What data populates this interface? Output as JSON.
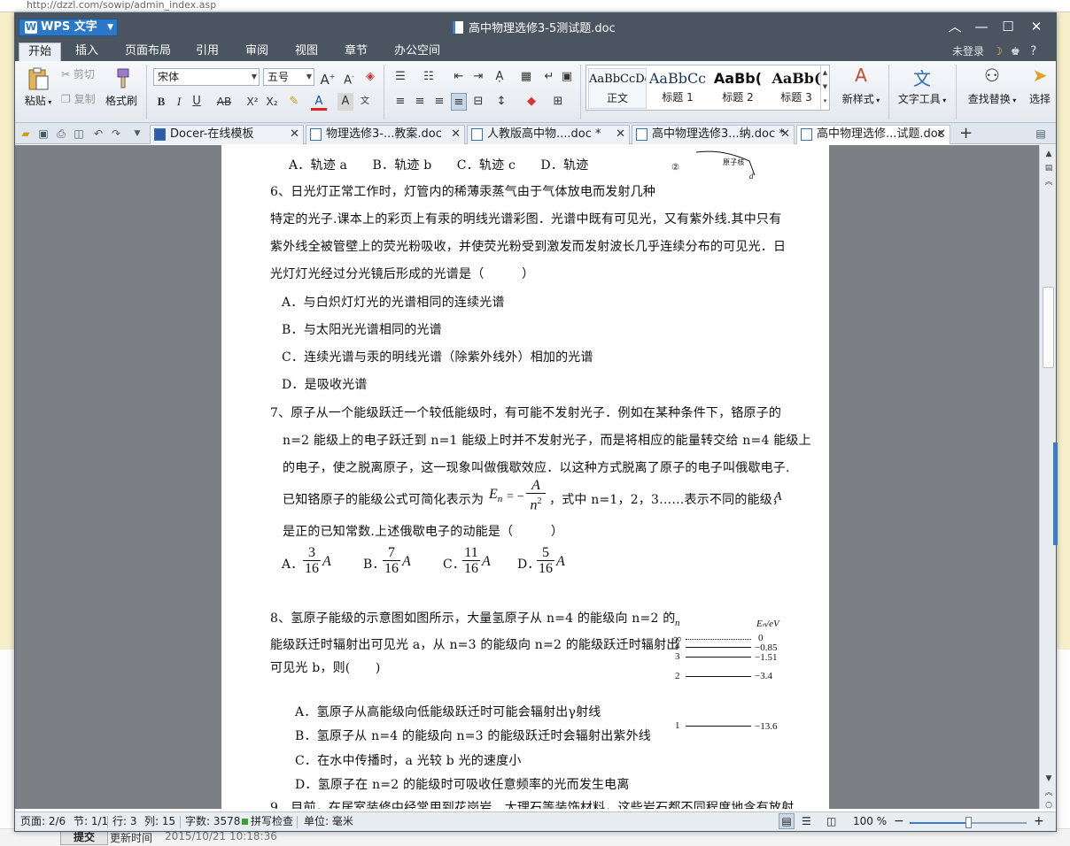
{
  "background": {
    "url": "http://dzzl.com/sowip/admin_index.asp",
    "submit_label": "提交",
    "update_label": "更新时间",
    "update_time": "2015/10/21 10:18:36"
  },
  "window": {
    "app_name": "WPS 文字",
    "doc_title": "高中物理选修3-5测试题.doc",
    "minimize": "—",
    "maximize": "☐",
    "close": "✕",
    "collapse": "︿"
  },
  "menu": {
    "items": [
      "开始",
      "插入",
      "页面布局",
      "引用",
      "审阅",
      "视图",
      "章节",
      "办公空间"
    ],
    "active_index": 0,
    "login": "未登录",
    "help": "?"
  },
  "ribbon": {
    "paste": "粘贴",
    "cut": "剪切",
    "copy": "复制",
    "format_painter": "格式刷",
    "font_name": "宋体",
    "font_size": "五号",
    "bold": "B",
    "italic": "I",
    "underline": "U",
    "strike": "AB",
    "superscript": "X²",
    "subscript": "X₂",
    "styles": [
      {
        "sample": "AaBbCcDd",
        "name": "正文"
      },
      {
        "sample": "AaBbCc",
        "name": "标题 1"
      },
      {
        "sample": "AaBb(",
        "name": "标题 2"
      },
      {
        "sample": "AaBb(",
        "name": "标题 3"
      }
    ],
    "new_style": "新样式",
    "text_tools": "文字工具",
    "find_replace": "查找替换",
    "select": "选择"
  },
  "tabs": [
    {
      "label": "Docer-在线模板",
      "active": false
    },
    {
      "label": "物理选修3-...教案.doc",
      "active": false
    },
    {
      "label": "人教版高中物....doc *",
      "active": false
    },
    {
      "label": "高中物理选修3...纳.doc *",
      "active": false
    },
    {
      "label": "高中物理选修...试题.doc",
      "active": true
    }
  ],
  "document": {
    "q5_options": "A．轨迹 a　　B．轨迹 b　　C．轨迹 c　　D．轨迹",
    "q5_fig_label_2": "②",
    "q5_fig_label_atom": "原子核",
    "q5_fig_label_d": "d",
    "q6_line1": "6、日光灯正常工作时，灯管内的稀薄汞蒸气由于气体放电而发射几种",
    "q6_line2": "特定的光子.课本上的彩页上有汞的明线光谱彩图．光谱中既有可见光，又有紫外线.其中只有",
    "q6_line3": "紫外线全被管壁上的荧光粉吸收，并使荧光粉受到激发而发射波长几乎连续分布的可见光．日",
    "q6_line4": "光灯灯光经过分光镜后形成的光谱是（　　　）",
    "q6_a": "A．与白炽灯灯光的光谱相同的连续光谱",
    "q6_b": "B．与太阳光光谱相同的光谱",
    "q6_c": "C．连续光谱与汞的明线光谱（除紫外线外）相加的光谱",
    "q6_d": "D．是吸收光谱",
    "q7_line1": "7、原子从一个能级跃迁一个较低能级时，有可能不发射光子．例如在某种条件下，铬原子的",
    "q7_line2": "n=2 能级上的电子跃迁到 n=1 能级上时并不发射光子，而是将相应的能量转交给 n=4 能级上",
    "q7_line3": "的电子，使之脱离原子，这一现象叫做俄歇效应．以这种方式脱离了原子的电子叫俄歇电子.",
    "q7_line4a": "已知铬原子的能级公式可简化表示为",
    "q7_formula_lhs": "E",
    "q7_formula_sub": "n",
    "q7_formula_eq": "= −",
    "q7_formula_num": "A",
    "q7_formula_den": "n",
    "q7_formula_pow": "2",
    "q7_line4b": "，式中 n=1，2，3……表示不同的能级，",
    "q7_line4c": "A",
    "q7_line5": "是正的已知常数.上述俄歇电子的动能是（　　　）",
    "q7_options": [
      {
        "label": "A．",
        "num": "3",
        "den": "16",
        "unit": "A"
      },
      {
        "label": "B．",
        "num": "7",
        "den": "16",
        "unit": "A"
      },
      {
        "label": "C．",
        "num": "11",
        "den": "16",
        "unit": "A"
      },
      {
        "label": "D．",
        "num": "5",
        "den": "16",
        "unit": "A"
      }
    ],
    "q8_line1": "8、氢原子能级的示意图如图所示，大量氢原子从 n=4 的能级向 n=2 的",
    "q8_line2": "能级跃迁时辐射出可见光 a，从 n=3 的能级向 n=2 的能级跃迁时辐射出",
    "q8_line3": "可见光 b，则(　　)",
    "q8_a": "A．氢原子从高能级向低能级跃迁时可能会辐射出γ射线",
    "q8_b": "B．氢原子从 n=4 的能级向 n=3 的能级跃迁时会辐射出紫外线",
    "q8_c": "C．在水中传播时，a 光较 b 光的速度小",
    "q8_d": "D．氢原子在 n=2 的能级时可吸收任意频率的光而发生电离",
    "q9_line1": "9、目前，在居室装修中经常用到花岗岩、大理石等装饰材料，这些岩石都不同程度地含有放射",
    "energy_diagram": {
      "n_header": "n",
      "e_header": "Eₙ/eV",
      "levels": [
        {
          "n": "∞",
          "e": "0"
        },
        {
          "n": "4",
          "e": "−0.85"
        },
        {
          "n": "3",
          "e": "−1.51"
        },
        {
          "n": "2",
          "e": "−3.4"
        },
        {
          "n": "1",
          "e": "−13.6"
        }
      ]
    }
  },
  "status": {
    "page": "页面: 2/6",
    "section": "节: 1/1",
    "row": "行: 3",
    "col": "列: 15",
    "words": "字数: 3578",
    "spell": "拼写检查",
    "unit": "单位: 毫米",
    "zoom": "100 %",
    "zoom_level_pct": 50
  }
}
